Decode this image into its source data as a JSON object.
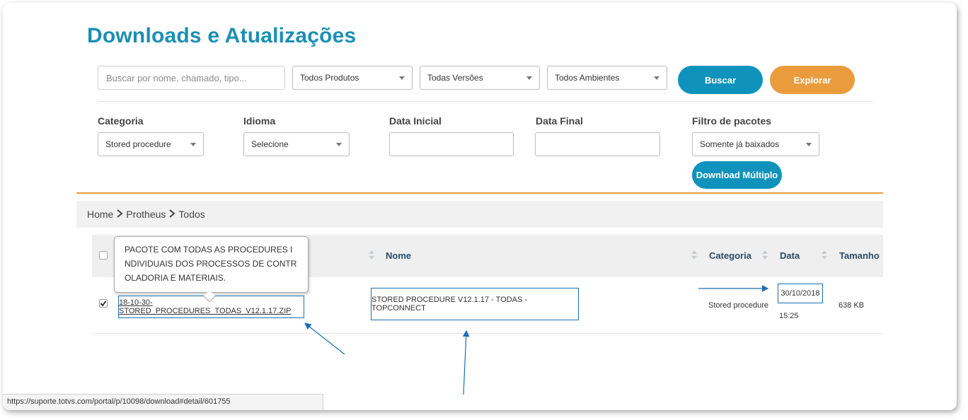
{
  "page": {
    "title": "Downloads e Atualizações"
  },
  "search": {
    "placeholder": "Buscar por nome, chamado, tipo...",
    "product": "Todos Produtos",
    "version": "Todas Versões",
    "environment": "Todos Ambientes",
    "search_button": "Buscar",
    "explore_button": "Explorar"
  },
  "filters": {
    "category_label": "Categoria",
    "category_value": "Stored procedure",
    "language_label": "Idioma",
    "language_value": "Selecione",
    "start_date_label": "Data Inicial",
    "end_date_label": "Data Final",
    "package_filter_label": "Filtro de pacotes",
    "package_filter_value": "Somente já baixados",
    "multi_download_button": "Download Múltiplo"
  },
  "breadcrumb": [
    "Home",
    "Protheus",
    "Todos"
  ],
  "table": {
    "headers": {
      "name": "Nome",
      "category": "Categoria",
      "date": "Data",
      "size": "Tamanho"
    },
    "rows": [
      {
        "checked": true,
        "file": "18-10-30-STORED_PROCEDURES_TODAS_V12.1.17.ZIP",
        "name": "STORED PROCEDURE V12.1.17 - TODAS - TOPCONNECT",
        "category": "Stored procedure",
        "date": "30/10/2018",
        "time": "15:25",
        "size": "638 KB"
      }
    ]
  },
  "tooltip": {
    "text": "PACOTE COM TODAS AS PROCEDURES INDIVIDUAIS DOS PROCESSOS DE CONTROLADORIA E MATERIAIS."
  },
  "status_bar": {
    "url": "https://suporte.totvs.com/portal/p/10098/download#detail/601755"
  },
  "colors": {
    "brand_blue": "#0f93bc",
    "accent_orange": "#ea9c3c",
    "annotation_blue": "#1a6fb8"
  }
}
